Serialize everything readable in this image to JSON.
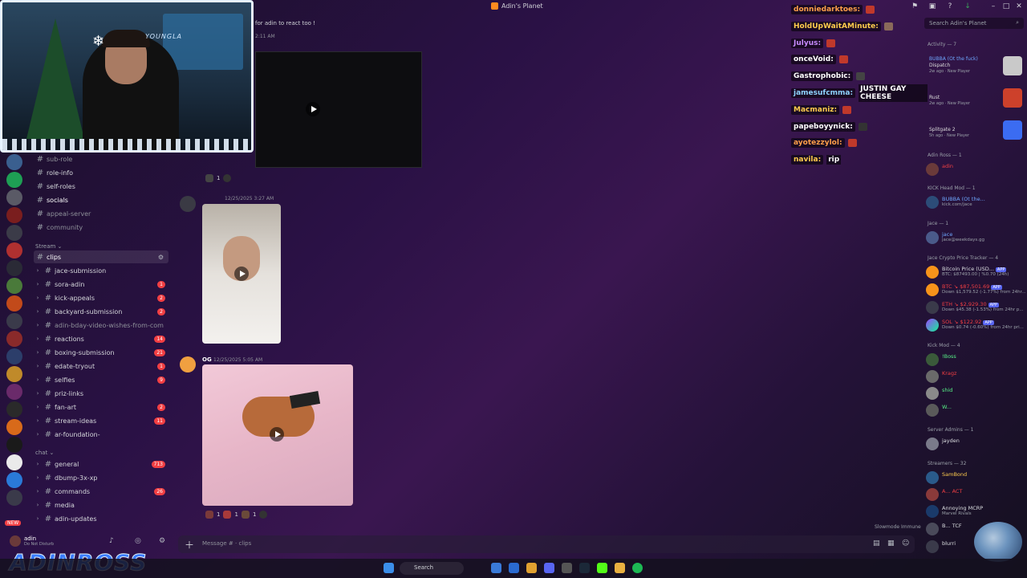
{
  "window": {
    "title": "Adin's Planet"
  },
  "channels": {
    "top": [
      "sub-role",
      "role-info",
      "self-roles",
      "socials",
      "appeal-server",
      "community"
    ],
    "stream_category": "Stream",
    "stream": [
      {
        "label": "clips",
        "count": ""
      },
      {
        "label": "jace-submission",
        "count": ""
      },
      {
        "label": "sora-adin",
        "count": "1"
      },
      {
        "label": "kick-appeals",
        "count": "2"
      },
      {
        "label": "backyard-submission",
        "count": "2"
      },
      {
        "label": "adin-bday-video-wishes-from-com",
        "count": ""
      },
      {
        "label": "reactions",
        "count": "14"
      },
      {
        "label": "boxing-submission",
        "count": "21"
      },
      {
        "label": "edate-tryout",
        "count": "1"
      },
      {
        "label": "selfies",
        "count": "9"
      },
      {
        "label": "priz-links",
        "count": ""
      },
      {
        "label": "fan-art",
        "count": "2"
      },
      {
        "label": "stream-ideas",
        "count": "11"
      },
      {
        "label": "ar-foundation-",
        "count": ""
      }
    ],
    "chat_category": "chat",
    "chat": [
      {
        "label": "general",
        "count": "713"
      },
      {
        "label": "dbump-3x-xp",
        "count": ""
      },
      {
        "label": "commands",
        "count": "26"
      },
      {
        "label": "media",
        "count": ""
      },
      {
        "label": "adin-updates",
        "count": ""
      }
    ]
  },
  "chat": {
    "top_text": "for adin to react too !",
    "top_time": "2:11 AM",
    "msg2_time": "12/25/2025 3:27 AM",
    "msg3_author": "OG",
    "msg3_time": "12/25/2025 5:05 AM",
    "reaction1_count": "1",
    "reactions3": [
      "1",
      "1",
      "1"
    ],
    "input_placeholder": "Message # · clips",
    "slowmode": "Slowmode Immune"
  },
  "stream_chat": [
    {
      "user": "donniedarktoes:",
      "color": "#ff9f4a",
      "msg": ""
    },
    {
      "user": "HoldUpWaitAMinute:",
      "color": "#ffcc4d",
      "msg": ""
    },
    {
      "user": "Julyus:",
      "color": "#c78bff",
      "msg": ""
    },
    {
      "user": "onceVoid:",
      "color": "#ffffff",
      "msg": ""
    },
    {
      "user": "Gastrophobic:",
      "color": "#ffffff",
      "msg": ""
    },
    {
      "user": "jamesufcmma:",
      "color": "#8fd3ff",
      "msg": "JUSTIN GAY CHEESE"
    },
    {
      "user": "Macmaniz:",
      "color": "#ffcc4d",
      "msg": ""
    },
    {
      "user": "papeboyynick:",
      "color": "#ffffff",
      "msg": ""
    },
    {
      "user": "ayotezzylol:",
      "color": "#ff9f4a",
      "msg": ""
    },
    {
      "user": "navila:",
      "color": "#ffcc4d",
      "msg": "rip"
    }
  ],
  "members": {
    "search_placeholder": "Search Adin's Planet",
    "activity_header": "Activity — 7",
    "activity": [
      {
        "name": "BUBBA (Ot the fuck)",
        "game": "Dispatch",
        "meta": "2w ago · New Player",
        "color": "#6ea6ff",
        "tile": "#c9c9c9"
      },
      {
        "name": "",
        "game": "Rust",
        "meta": "2w ago · New Player",
        "color": "#6ea6ff",
        "tile": "#cd412b"
      },
      {
        "name": "",
        "game": "Splitgate 2",
        "meta": "5h ago · New Player",
        "color": "#6ea6ff",
        "tile": "#3b6cf2"
      }
    ],
    "groups": [
      {
        "header": "Adin Ross — 1",
        "items": [
          {
            "name": "adin",
            "sub": "",
            "color": "#f23f43"
          }
        ]
      },
      {
        "header": "KICK Head Mod — 1",
        "items": [
          {
            "name": "BUBBA (Ot the...",
            "sub": "kick.com/jace",
            "color": "#6ea6ff"
          }
        ]
      },
      {
        "header": "Jace — 1",
        "items": [
          {
            "name": "jace",
            "sub": "jace@weekdays.gg",
            "color": "#6ea6ff"
          }
        ]
      },
      {
        "header": "Jace Crypto Price Tracker — 4",
        "items": [
          {
            "name": "Bitcoin Price (USD...",
            "sub": "BTC: $87493.00 | %0.70 (24h)",
            "color": "#dbdee1",
            "app": "APP"
          },
          {
            "name": "BTC ↘ $87,501.69",
            "sub": "Down $1,579.52 (-1.77%) from 24hr...",
            "color": "#f23f43",
            "app": "APP"
          },
          {
            "name": "ETH ↘ $2,929.30",
            "sub": "Down $45.38 (-1.53%) from 24hr p...",
            "color": "#f23f43",
            "app": "APP"
          },
          {
            "name": "SOL ↘ $122.92",
            "sub": "Down $0.74 (-0.60%) from 24hr pri...",
            "color": "#f23f43",
            "app": "APP"
          }
        ]
      },
      {
        "header": "Kick Mod — 4",
        "items": [
          {
            "name": "!Boss",
            "sub": "",
            "color": "#57f287"
          },
          {
            "name": "Kragz",
            "sub": "",
            "color": "#f23f43"
          },
          {
            "name": "shid",
            "sub": "",
            "color": "#57f287"
          },
          {
            "name": "W...",
            "sub": "",
            "color": "#57f287"
          }
        ]
      },
      {
        "header": "Server Admins — 1",
        "items": [
          {
            "name": "jayden",
            "sub": "",
            "color": "#dbdee1"
          }
        ]
      },
      {
        "header": "Streamers — 32",
        "items": [
          {
            "name": "SamBond",
            "sub": "",
            "color": "#ffcc4d"
          },
          {
            "name": "A... ACT",
            "sub": "",
            "color": "#f23f43"
          },
          {
            "name": "Annoying  MCRP",
            "sub": "Marvel Rivals",
            "color": "#dbdee1"
          },
          {
            "name": "B...  TCF",
            "sub": "",
            "color": "#dbdee1"
          },
          {
            "name": "blurri",
            "sub": "",
            "color": "#dbdee1"
          }
        ]
      }
    ]
  },
  "user_panel": {
    "name": "adin",
    "status": "Do Not Disturb"
  },
  "banner": {
    "text": "ADINROSS",
    "new": "NEW"
  },
  "webcam": {
    "brand": "YOUNGLA"
  },
  "taskbar": {
    "search": "Search"
  }
}
